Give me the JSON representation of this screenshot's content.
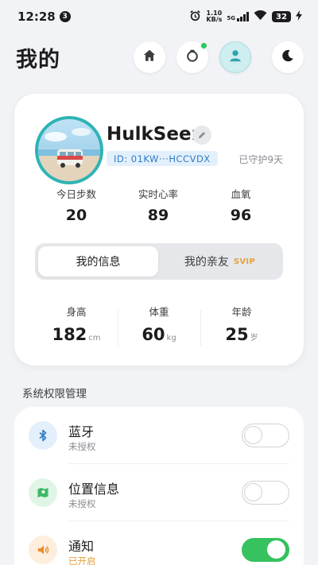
{
  "status_bar": {
    "time": "12:28",
    "notif_count": "3",
    "net_speed_value": "1.10",
    "net_speed_unit": "KB/s",
    "network_type": "5G",
    "battery": "32",
    "icons": [
      "alarm-icon",
      "signal-icon",
      "wifi-icon",
      "battery-icon",
      "charging-icon"
    ]
  },
  "header": {
    "title": "我的",
    "buttons": [
      "home-icon",
      "ring-icon",
      "user-icon",
      "moon-icon"
    ],
    "ring_badge_color": "#2fc85a"
  },
  "profile": {
    "username": "HulkSeen",
    "id_text": "ID: 01KW···HCCVDX",
    "guard_text": "已守护9天",
    "stats": [
      {
        "label": "今日步数",
        "value": "20"
      },
      {
        "label": "实时心率",
        "value": "89"
      },
      {
        "label": "血氧",
        "value": "96"
      }
    ],
    "tabs": {
      "active": "我的信息",
      "inactive": "我的亲友",
      "badge": "SVIP"
    },
    "measures": [
      {
        "label": "身高",
        "value": "182",
        "unit": "cm"
      },
      {
        "label": "体重",
        "value": "60",
        "unit": "kg"
      },
      {
        "label": "年龄",
        "value": "25",
        "unit": "岁"
      }
    ]
  },
  "permissions": {
    "section_title": "系统权限管理",
    "items": [
      {
        "name": "蓝牙",
        "status": "未授权",
        "enabled": false,
        "icon": "bluetooth-icon"
      },
      {
        "name": "位置信息",
        "status": "未授权",
        "enabled": false,
        "icon": "map-icon"
      },
      {
        "name": "通知",
        "status": "已开启",
        "enabled": true,
        "icon": "speaker-icon"
      }
    ]
  },
  "colors": {
    "accent_teal": "#2fb3b5",
    "toggle_on": "#35c25f",
    "svip": "#e7a23b",
    "id_chip_text": "#2f7cc3"
  }
}
